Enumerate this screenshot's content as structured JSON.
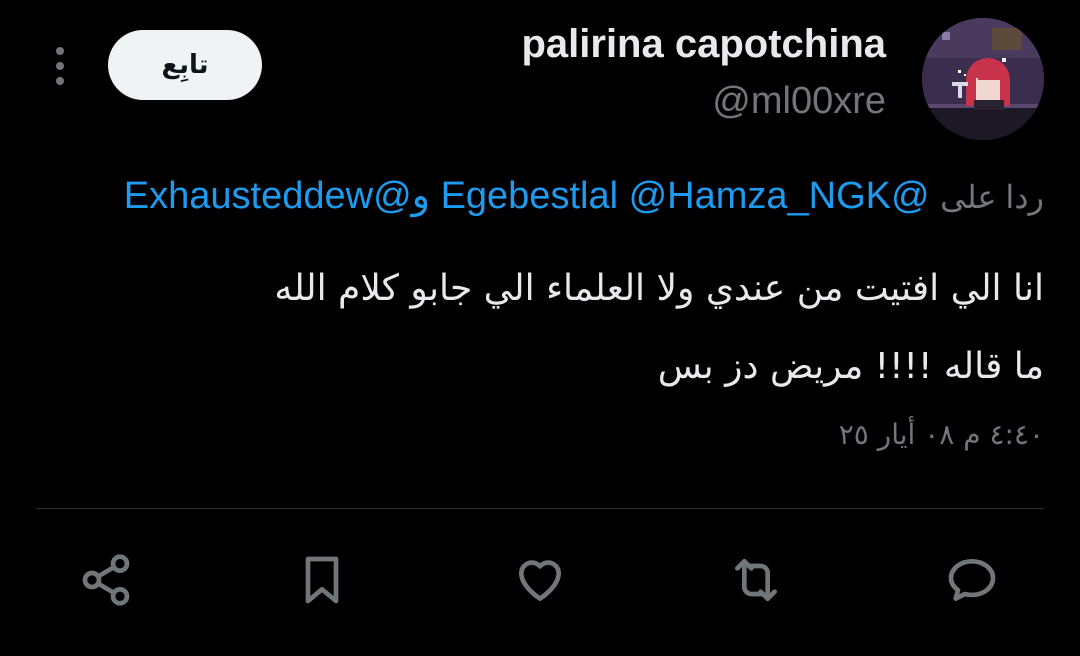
{
  "header": {
    "follow_label": "تابِع",
    "display_name": "palirina capotchina",
    "handle": "@ml00xre"
  },
  "reply": {
    "prefix": "ردا على",
    "mentions": [
      "@Egebestlal",
      "@Hamza_NGK",
      "@Exhausteddew"
    ],
    "conjunction": "و"
  },
  "tweet": {
    "text_line1": "انا الي افتيت من عندي ولا العلماء الي جابو كلام الله",
    "text_line2": "ما قاله !!!! مريض دز بس",
    "timestamp": "٤:٤٠ م ٠٨ أيار ٢٥"
  },
  "actions": {
    "icons": [
      "share-icon",
      "bookmark-icon",
      "like-icon",
      "retweet-icon",
      "reply-icon"
    ]
  },
  "colors": {
    "background": "#000000",
    "text": "#e7e9ea",
    "muted": "#71767b",
    "link": "#1d9bf0",
    "follow_bg": "#eff3f4"
  }
}
